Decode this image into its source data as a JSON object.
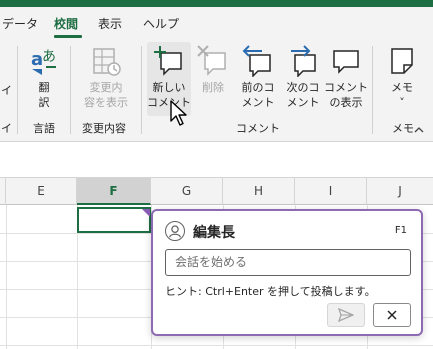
{
  "tabs": [
    {
      "label": "データ"
    },
    {
      "label": "校閲"
    },
    {
      "label": "表示"
    },
    {
      "label": "ヘルプ"
    }
  ],
  "ribbon": {
    "left_cut_labels": [
      "イ",
      "イ"
    ],
    "translate_button": {
      "label": "翻\n訳"
    },
    "changes_button": {
      "label": "変更内\n容を表示"
    },
    "new_comment_button": {
      "label": "新しい\nコメント"
    },
    "delete_button": {
      "label": "削除"
    },
    "prev_comment_button": {
      "label": "前のコ\nメント"
    },
    "next_comment_button": {
      "label": "次のコ\nメント"
    },
    "show_comments_button": {
      "label": "コメント\nの表示"
    },
    "notes_button": {
      "label": "メモ\n˅"
    },
    "groups": {
      "language": "言語",
      "changes": "変更内容",
      "comments": "コメント",
      "notes": "メモ"
    }
  },
  "columns": [
    "E",
    "F",
    "G",
    "H",
    "I",
    "J"
  ],
  "comment_card": {
    "author": "編集長",
    "cell_ref": "F1",
    "input_placeholder": "会話を始める",
    "hint": "ヒント: Ctrl+Enter を押して投稿します。"
  },
  "colors": {
    "accent": "#1e6e43",
    "comment_border": "#8e6ab2",
    "comment_marker": "#8b5cb8"
  }
}
